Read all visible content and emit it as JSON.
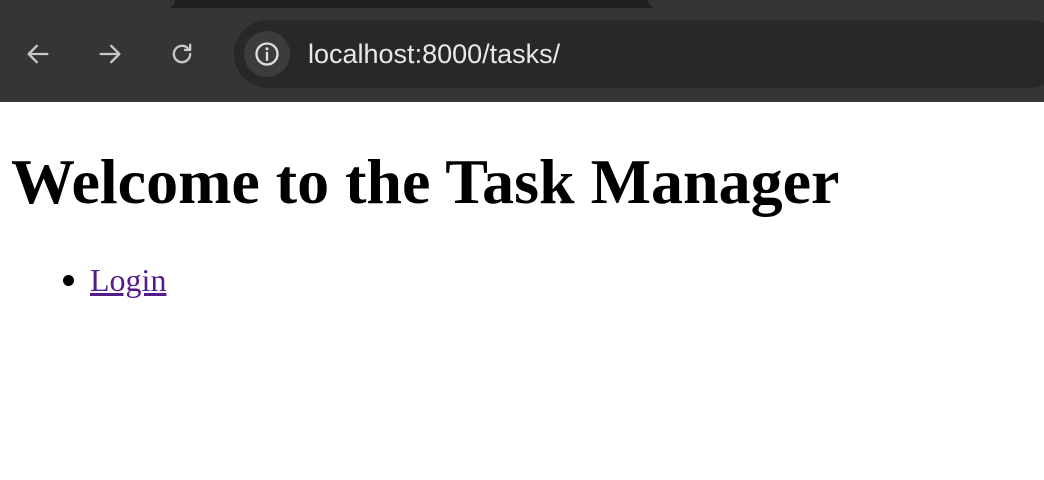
{
  "browser": {
    "url": "localhost:8000/tasks/",
    "back_icon": "arrow-left-icon",
    "forward_icon": "arrow-right-icon",
    "reload_icon": "reload-icon",
    "site_info_icon": "info-icon"
  },
  "page": {
    "heading": "Welcome to the Task Manager",
    "links": [
      {
        "label": "Login"
      }
    ]
  },
  "colors": {
    "chrome_background": "#353535",
    "omnibox_background": "#282828",
    "visited_link": "#551a8b"
  }
}
